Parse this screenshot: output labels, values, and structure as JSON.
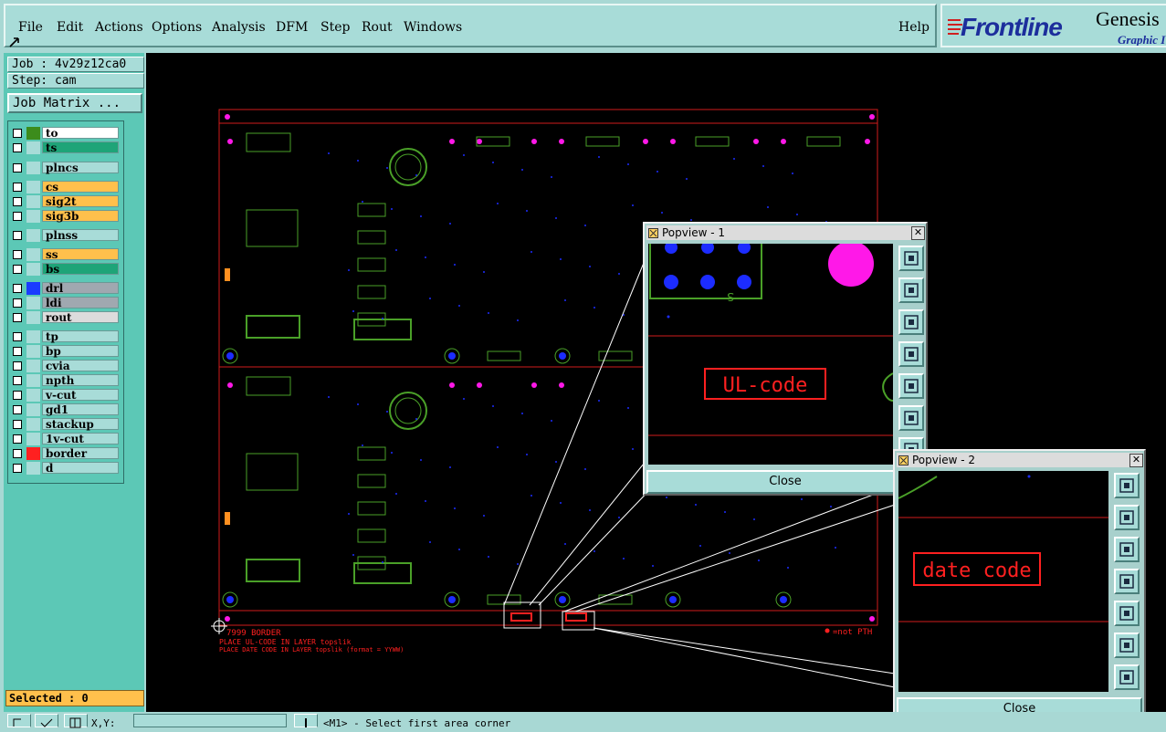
{
  "menu": {
    "file": "File",
    "edit": "Edit",
    "actions": "Actions",
    "options": "Options",
    "analysis": "Analysis",
    "dfm": "DFM",
    "step": "Step",
    "rout": "Rout",
    "windows": "Windows",
    "help": "Help"
  },
  "logo": {
    "brand": "Frontline",
    "product": "Genesis",
    "tagline": "Graphic I"
  },
  "job": {
    "job_label": "Job : 4v29z12ca0",
    "step_label": "Step: cam",
    "matrix_button": "Job Matrix ..."
  },
  "layers": [
    {
      "name": "to",
      "color": "#3c8c1c",
      "bg": "#ffffff"
    },
    {
      "name": "ts",
      "color": "#a8dcd8",
      "bg": "#1ea478"
    },
    {
      "name": "plncs",
      "color": "#a8dcd8",
      "bg": "#a8dcd8"
    },
    {
      "name": "cs",
      "color": "#a8dcd8",
      "bg": "#ffc04c"
    },
    {
      "name": "sig2t",
      "color": "#a8dcd8",
      "bg": "#ffc04c"
    },
    {
      "name": "sig3b",
      "color": "#a8dcd8",
      "bg": "#ffc04c"
    },
    {
      "name": "plnss",
      "color": "#a8dcd8",
      "bg": "#a8dcd8"
    },
    {
      "name": "ss",
      "color": "#a8dcd8",
      "bg": "#ffc04c"
    },
    {
      "name": "bs",
      "color": "#a8dcd8",
      "bg": "#1ea478"
    },
    {
      "name": "drl",
      "color": "#1a3cff",
      "bg": "#a0a8b0"
    },
    {
      "name": "ldi",
      "color": "#a8dcd8",
      "bg": "#a0a8b0"
    },
    {
      "name": "rout",
      "color": "#a8dcd8",
      "bg": "#dcdcdc"
    },
    {
      "name": "tp",
      "color": "#a8dcd8",
      "bg": "#a8dcd8"
    },
    {
      "name": "bp",
      "color": "#a8dcd8",
      "bg": "#a8dcd8"
    },
    {
      "name": "cvia",
      "color": "#a8dcd8",
      "bg": "#a8dcd8"
    },
    {
      "name": "npth",
      "color": "#a8dcd8",
      "bg": "#a8dcd8"
    },
    {
      "name": "v-cut",
      "color": "#a8dcd8",
      "bg": "#a8dcd8"
    },
    {
      "name": "gd1",
      "color": "#a8dcd8",
      "bg": "#a8dcd8"
    },
    {
      "name": "stackup",
      "color": "#a8dcd8",
      "bg": "#a8dcd8"
    },
    {
      "name": "1v-cut",
      "color": "#a8dcd8",
      "bg": "#a8dcd8"
    },
    {
      "name": "border",
      "color": "#ff2020",
      "bg": "#a8dcd8"
    },
    {
      "name": "d",
      "color": "#a8dcd8",
      "bg": "#a8dcd8"
    }
  ],
  "selected": "Selected : 0",
  "popview1": {
    "title": "Popview - 1",
    "label_text": "UL-code",
    "close": "Close"
  },
  "popview2": {
    "title": "Popview - 2",
    "label_text": "date code",
    "close": "Close"
  },
  "canvas_notes": {
    "border": "7999 BORDER",
    "ul_note": "PLACE UL-CODE IN LAYER topslik",
    "date_note": "PLACE DATE CODE IN LAYER topslik (format = YYWW)",
    "not_pth": "=not PTH"
  },
  "status": {
    "xy": "X,Y:",
    "prompt": "<M1> - Select first area corner"
  }
}
